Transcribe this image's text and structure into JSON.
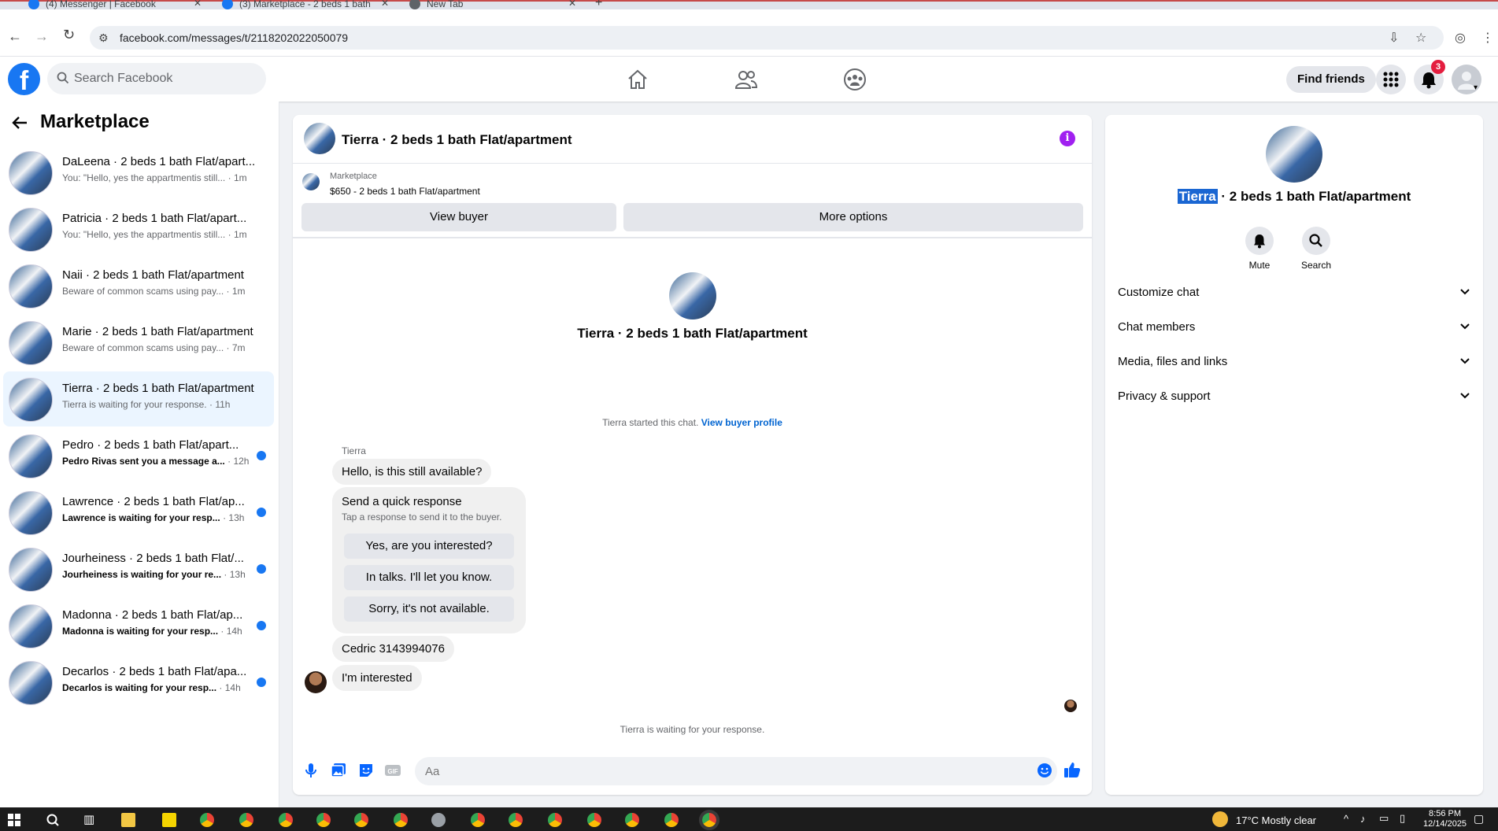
{
  "browser": {
    "tabs": [
      {
        "label": "(4) Messenger | Facebook"
      },
      {
        "label": "(3) Marketplace - 2 beds 1 bath"
      },
      {
        "label": "New Tab"
      }
    ],
    "url": "facebook.com/messages/t/2118202022050079"
  },
  "header": {
    "logo": "f",
    "search_placeholder": "Search Facebook",
    "find_friends": "Find friends",
    "notification_count": "3",
    "nav_icons": [
      "home-icon",
      "friends-icon",
      "groups-icon"
    ]
  },
  "sidebar": {
    "title": "Marketplace",
    "conversations": [
      {
        "name": "DaLeena · 2 beds 1 bath Flat/apart...",
        "preview": "You: \"Hello, yes the appartmentis still...",
        "time": "· 1m",
        "unread": false
      },
      {
        "name": "Patricia · 2 beds 1 bath Flat/apart...",
        "preview": "You: \"Hello, yes the appartmentis still...",
        "time": "· 1m",
        "unread": false
      },
      {
        "name": "Naii · 2 beds 1 bath Flat/apartment",
        "preview": "Beware of common scams using pay...",
        "time": "· 1m",
        "unread": false
      },
      {
        "name": "Marie · 2 beds 1 bath Flat/apartment",
        "preview": "Beware of common scams using pay...",
        "time": "· 7m",
        "unread": false
      },
      {
        "name": "Tierra · 2 beds 1 bath Flat/apartment",
        "preview": "Tierra is waiting for your response.",
        "time": "· 11h",
        "unread": false,
        "active": true
      },
      {
        "name": "Pedro · 2 beds 1 bath Flat/apart...",
        "preview": "Pedro Rivas sent you a message a...",
        "time": "· 12h",
        "unread": true
      },
      {
        "name": "Lawrence · 2 beds 1 bath Flat/ap...",
        "preview": "Lawrence is waiting for your resp...",
        "time": "· 13h",
        "unread": true
      },
      {
        "name": "Jourheiness · 2 beds 1 bath Flat/...",
        "preview": "Jourheiness is waiting for your re...",
        "time": "· 13h",
        "unread": true
      },
      {
        "name": "Madonna · 2 beds 1 bath Flat/ap...",
        "preview": "Madonna is waiting for your resp...",
        "time": "· 14h",
        "unread": true
      },
      {
        "name": "Decarlos · 2 beds 1 bath Flat/apa...",
        "preview": "Decarlos is waiting for your resp...",
        "time": "· 14h",
        "unread": true
      }
    ]
  },
  "chat": {
    "title": "Tierra · 2 beds 1 bath Flat/apartment",
    "listing_label": "Marketplace",
    "listing_price": "$650 - 2 beds 1 bath Flat/apartment",
    "view_buyer": "View buyer",
    "more_options": "More options",
    "intro_title": "Tierra · 2 beds 1 bath Flat/apartment",
    "started_text": "Tierra started this chat.",
    "view_buyer_profile": "View buyer profile",
    "sender_name": "Tierra",
    "messages": [
      "Hello, is this still available?",
      "Cedric 3143994076",
      "I'm interested"
    ],
    "quick_response": {
      "title": "Send a quick response",
      "subtitle": "Tap a response to send it to the buyer.",
      "options": [
        "Yes, are you interested?",
        "In talks. I'll let you know.",
        "Sorry, it's not available."
      ]
    },
    "waiting": "Tierra is waiting for your response.",
    "input_placeholder": "Aa"
  },
  "right_panel": {
    "title_highlight": "Tierra",
    "title_rest": " · 2 beds 1 bath Flat/apartment",
    "mute": "Mute",
    "search": "Search",
    "sections": [
      "Customize chat",
      "Chat members",
      "Media, files and links",
      "Privacy & support"
    ]
  },
  "taskbar": {
    "weather": "17°C  Mostly clear",
    "time": "8:56 PM",
    "date": "12/14/2025"
  },
  "colors": {
    "brand": "#1877f2",
    "active_conversation": "#ebf5ff",
    "unread_dot": "#1877f2",
    "info_button": "#a020f0",
    "badge": "#e41e3f"
  }
}
